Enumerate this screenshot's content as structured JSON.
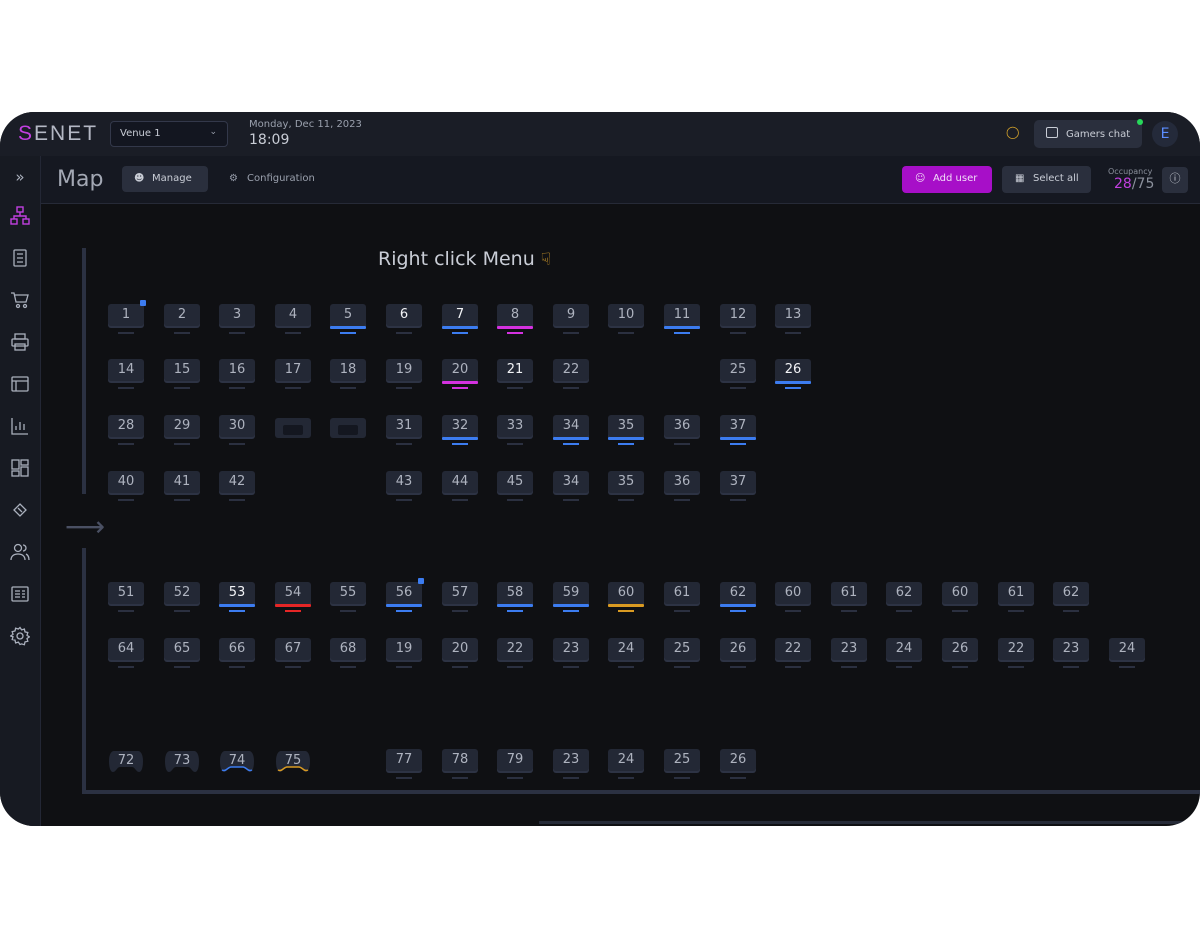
{
  "app": {
    "logo_accent": "S",
    "logo_rest": "ENET"
  },
  "header": {
    "venue": "Venue 1",
    "date": "Monday, Dec 11, 2023",
    "time": "18:09",
    "gamers_chat": "Gamers chat",
    "avatar_initial": "E"
  },
  "sidebar": {
    "icons": [
      "expand-icon",
      "map-icon",
      "registers-icon",
      "cart-icon",
      "printer-icon",
      "window-icon",
      "stats-icon",
      "dashboard-icon",
      "ticket-icon",
      "users-icon",
      "reports-icon",
      "settings-icon"
    ]
  },
  "subheader": {
    "title": "Map",
    "tab_manage": "Manage",
    "tab_configuration": "Configuration",
    "add_user": "Add user",
    "select_all": "Select all",
    "occupancy_label": "Occupancy",
    "occupancy_current": "28",
    "occupancy_total": "/75"
  },
  "map": {
    "hint": "Right click Menu",
    "rows": [
      [
        {
          "label": "1",
          "dot": true
        },
        {
          "label": "2"
        },
        {
          "label": "3"
        },
        {
          "label": "4"
        },
        {
          "label": "5",
          "status": "blue"
        },
        {
          "label": "6",
          "bright": true
        },
        {
          "label": "7",
          "status": "blue",
          "bright": true
        },
        {
          "label": "8",
          "status": "pink"
        },
        {
          "label": "9"
        },
        {
          "label": "10"
        },
        {
          "label": "11",
          "status": "blue"
        },
        {
          "label": "12"
        },
        {
          "label": "13"
        }
      ],
      [
        {
          "label": "14"
        },
        {
          "label": "15"
        },
        {
          "label": "16"
        },
        {
          "label": "17"
        },
        {
          "label": "18"
        },
        {
          "label": "19"
        },
        {
          "label": "20",
          "status": "pink"
        },
        {
          "label": "21",
          "bright": true
        },
        {
          "label": "22"
        },
        null,
        null,
        {
          "label": "25"
        },
        {
          "label": "26",
          "status": "blue",
          "bright": true
        }
      ],
      [
        {
          "label": "28"
        },
        {
          "label": "29"
        },
        {
          "label": "30"
        },
        {
          "couch": true
        },
        {
          "couch": true
        },
        {
          "label": "31"
        },
        {
          "label": "32",
          "status": "blue"
        },
        {
          "label": "33"
        },
        {
          "label": "34",
          "status": "blue"
        },
        {
          "label": "35",
          "status": "blue"
        },
        {
          "label": "36"
        },
        {
          "label": "37",
          "status": "blue"
        }
      ],
      [
        {
          "label": "40"
        },
        {
          "label": "41"
        },
        {
          "label": "42"
        },
        null,
        null,
        {
          "label": "43"
        },
        {
          "label": "44"
        },
        {
          "label": "45"
        },
        {
          "label": "34"
        },
        {
          "label": "35"
        },
        {
          "label": "36"
        },
        {
          "label": "37"
        }
      ],
      [
        {
          "label": "51"
        },
        {
          "label": "52"
        },
        {
          "label": "53",
          "status": "blue",
          "bright": true
        },
        {
          "label": "54",
          "status": "red"
        },
        {
          "label": "55"
        },
        {
          "label": "56",
          "status": "blue",
          "dot": true
        },
        {
          "label": "57"
        },
        {
          "label": "58",
          "status": "blue"
        },
        {
          "label": "59",
          "status": "blue"
        },
        {
          "label": "60",
          "status": "yellow"
        },
        {
          "label": "61"
        },
        {
          "label": "62",
          "status": "blue"
        },
        {
          "label": "60"
        },
        {
          "label": "61"
        },
        {
          "label": "62"
        },
        {
          "label": "60"
        },
        {
          "label": "61"
        },
        {
          "label": "62"
        }
      ],
      [
        {
          "label": "64"
        },
        {
          "label": "65"
        },
        {
          "label": "66"
        },
        {
          "label": "67"
        },
        {
          "label": "68"
        },
        {
          "label": "19"
        },
        {
          "label": "20"
        },
        {
          "label": "22"
        },
        {
          "label": "23"
        },
        {
          "label": "24"
        },
        {
          "label": "25"
        },
        {
          "label": "26"
        },
        {
          "label": "22"
        },
        {
          "label": "23"
        },
        {
          "label": "24"
        },
        {
          "label": "26"
        },
        {
          "label": "22"
        },
        {
          "label": "23"
        },
        {
          "label": "24"
        }
      ],
      [
        {
          "label": "72",
          "gamepad": true
        },
        {
          "label": "73",
          "gamepad": true
        },
        {
          "label": "74",
          "gamepad": true,
          "status": "blue"
        },
        {
          "label": "75",
          "gamepad": true,
          "status": "yellow"
        },
        null,
        {
          "label": "77"
        },
        {
          "label": "78"
        },
        {
          "label": "79"
        },
        {
          "label": "23"
        },
        {
          "label": "24"
        },
        {
          "label": "25"
        },
        {
          "label": "26"
        }
      ]
    ]
  },
  "colors": {
    "accent": "#c23fe0",
    "blue": "#3c7cf0",
    "pink": "#d431e0",
    "red": "#e52626",
    "yellow": "#d99a22"
  }
}
